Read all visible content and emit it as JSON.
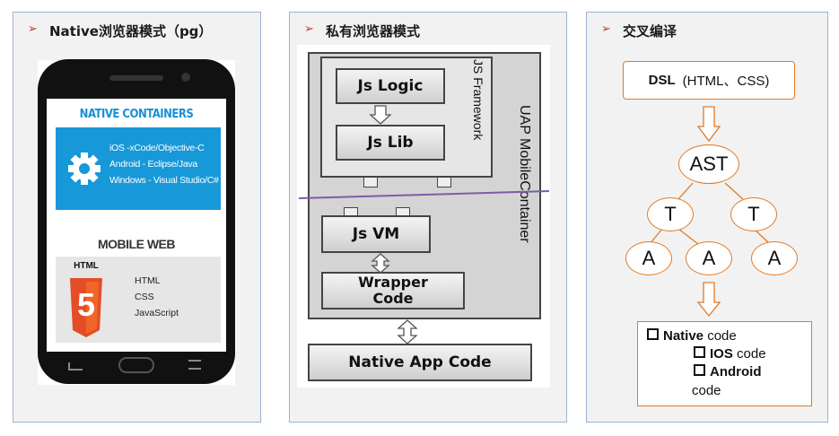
{
  "panels": {
    "left": {
      "bullet": "➢",
      "title": "Native浏览器模式（pg）"
    },
    "middle": {
      "bullet": "➢",
      "title": "私有浏览器模式"
    },
    "right": {
      "bullet": "➢",
      "title": "交叉编译"
    }
  },
  "phone": {
    "native_heading": "NATIVE CONTAINERS",
    "native_lines": [
      "iOS -xCode/Objective-C",
      "Android - Eclipse/Java",
      "Windows - Visual Studio/C#"
    ],
    "mobile_heading": "MOBILE WEB",
    "html5_label": "HTML",
    "html5_number": "5",
    "web_lines": [
      "HTML",
      "CSS",
      "JavaScript"
    ]
  },
  "private_mode": {
    "js_logic": "Js Logic",
    "js_lib": "Js Lib",
    "js_framework": "JS Framework",
    "container": "UAP MobileContainer",
    "js_vm": "Js VM",
    "wrapper_line1": "Wrapper",
    "wrapper_line2": "Code",
    "native_app": "Native App Code"
  },
  "cross_compile": {
    "dsl_bold": "DSL",
    "dsl_rest": "(HTML、CSS)",
    "ast": "AST",
    "t": "T",
    "a": "A",
    "native_bold": "Native",
    "native_rest": " code",
    "ios_bold": "IOS",
    "ios_rest": " code",
    "android_bold": "Android",
    "android_rest": "code"
  },
  "colors": {
    "accent_orange": "#e07b27",
    "phone_blue": "#1798d8",
    "html5_orange": "#e44d26",
    "bullet_red": "#c0392b"
  }
}
